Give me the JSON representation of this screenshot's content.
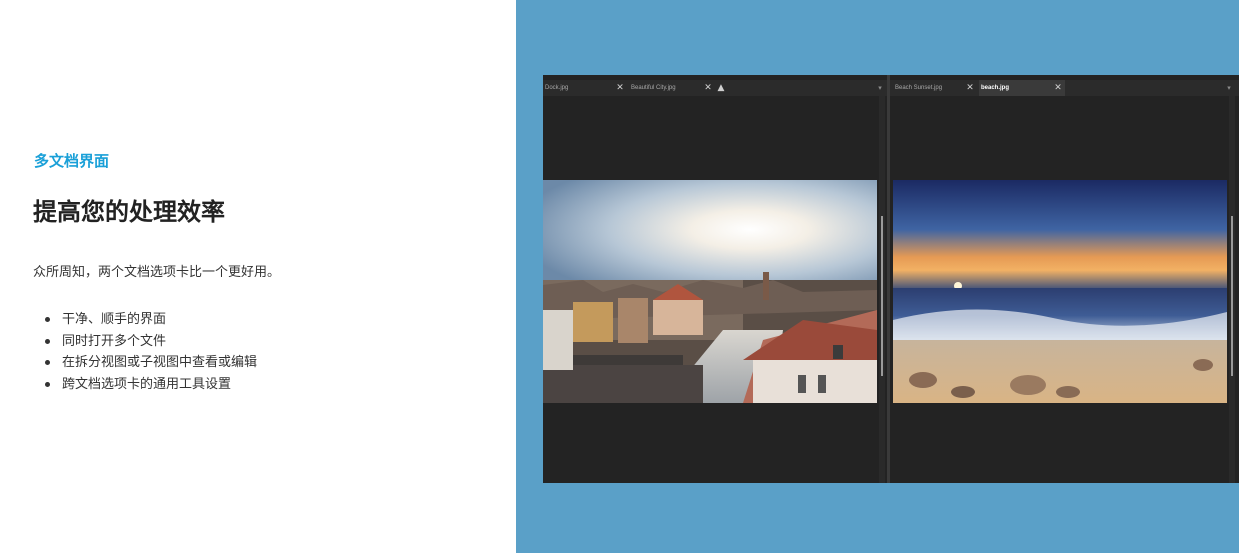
{
  "intro_section": {
    "eyebrow": "多文档界面",
    "headline": "提高您的处理效率",
    "intro": "众所周知，两个文档选项卡比一个更好用。",
    "bullets": [
      "干净、顺手的界面",
      "同时打开多个文件",
      "在拆分视图或子视图中查看或编辑",
      "跨文档选项卡的通用工具设置"
    ]
  },
  "colors": {
    "accent": "#1aa0d8",
    "panel_background": "#5aa0c8",
    "app_background": "#232323"
  },
  "app_window": {
    "left_pane": {
      "tabs": [
        {
          "label": "Dock.jpg",
          "active": false
        },
        {
          "label": "Beautiful City.jpg",
          "active": false
        }
      ],
      "close_icon": "close-icon",
      "add_icon": "add-tab-icon",
      "image_subject": "city-rooftops-image"
    },
    "right_pane": {
      "tabs": [
        {
          "label": "Beach Sunset.jpg",
          "active": false
        },
        {
          "label": "beach.jpg",
          "active": true
        }
      ],
      "close_icon": "close-icon",
      "image_subject": "beach-sunset-image"
    }
  }
}
